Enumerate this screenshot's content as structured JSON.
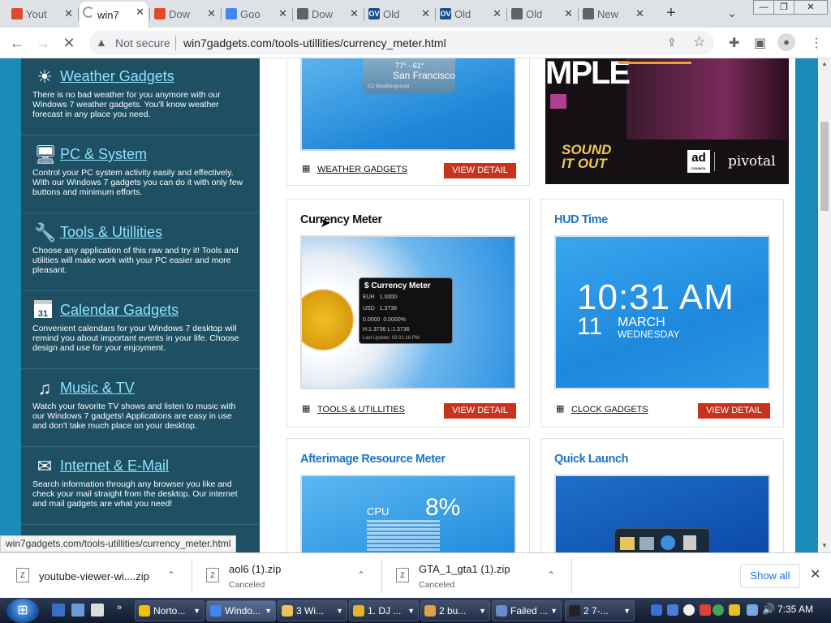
{
  "browser": {
    "tabs": [
      {
        "title": "Yout",
        "favicon": "windows-flag-icon",
        "color": "#e04b2b"
      },
      {
        "title": "win7",
        "favicon": "loading-icon",
        "color": "#9aa0a6",
        "active": true
      },
      {
        "title": "Dow",
        "favicon": "windows-flag-icon",
        "color": "#e04b2b"
      },
      {
        "title": "Goo",
        "favicon": "google-g-icon",
        "color": "#4285f4"
      },
      {
        "title": "Dow",
        "favicon": "globe-icon",
        "color": "#5f6368"
      },
      {
        "title": "Old",
        "favicon": "ov-icon",
        "color": "#1b4f8a",
        "badge": "OV"
      },
      {
        "title": "Old",
        "favicon": "ov-icon",
        "color": "#1b4f8a",
        "badge": "OV"
      },
      {
        "title": "Old",
        "favicon": "globe-icon",
        "color": "#5f6368"
      },
      {
        "title": "New",
        "favicon": "globe-icon",
        "color": "#5f6368"
      }
    ],
    "new_tab_glyph": "+",
    "tab_search_glyph": "⌄",
    "window_controls": {
      "minimize": "—",
      "maximize": "❐",
      "close": "✕"
    },
    "nav": {
      "back": "←",
      "forward": "→",
      "stop": "✕"
    },
    "security_label": "Not secure",
    "url": "win7gadgets.com/tools-utillities/currency_meter.html",
    "status_url": "win7gadgets.com/tools-utillities/currency_meter.html"
  },
  "sidebar": {
    "items": [
      {
        "title": "Weather Gadgets",
        "icon": "weather-icon",
        "glyph": "☀",
        "desc": "There is no bad weather for you anymore with our Windows 7 weather gadgets. You'll know weather forecast in any place you need."
      },
      {
        "title": "PC & System",
        "icon": "monitor-icon",
        "glyph": "🖥",
        "desc": "Control your PC system activity easily and effectively. With our Windows 7 gadgets you can do it with only few buttons and minimum efforts."
      },
      {
        "title": "Tools & Utillities",
        "icon": "wrench-icon",
        "glyph": "🔧",
        "desc": "Choose any application of this raw and try it! Tools and utilities will make work with your PC easier and more pleasant."
      },
      {
        "title": "Calendar Gadgets",
        "icon": "calendar-icon",
        "glyph": "31",
        "desc": "Convenient calendars for your Windows 7 desktop will remind you about important events in your life. Choose design and use for your enjoyment."
      },
      {
        "title": "Music & TV",
        "icon": "music-note-icon",
        "glyph": "♫",
        "desc": "Watch your favorite TV shows and listen to music with our Windows 7 gadgets! Applications are easy in use and don't take much place on your desktop."
      },
      {
        "title": "Internet & E-Mail",
        "icon": "envelope-icon",
        "glyph": "✉",
        "desc": "Search information through any browser you like and check your mail straight from the desktop. Our internet and mail gadgets are what you need!"
      }
    ]
  },
  "cards": {
    "top_left": {
      "category": "WEATHER GADGETS",
      "button": "VIEW DETAIL",
      "img_text": {
        "temps": "77° - 61°",
        "city": "San Francisco",
        "credit": "(C) Weatherground"
      }
    },
    "top_right": {
      "ad_title": "MPLE",
      "ad_brand": "SOUND IT OUT",
      "ad_logo1": "ad",
      "ad_logo1_sub": "COUNCIL",
      "ad_logo2": "pivotal"
    },
    "currency": {
      "title": "Currency Meter",
      "category": "TOOLS & UTILLITIES",
      "button": "VIEW DETAIL",
      "widget": {
        "title": "Currency Meter",
        "eur_label": "EUR",
        "eur_value": "1.0000",
        "usd_label": "USD",
        "usd_value": "1.3736",
        "pct1": "0.0000",
        "pct2": "0.0000%",
        "hl": "H:1.3736  L:1.3736",
        "updated": "Last Update: 02:01:18 PM"
      }
    },
    "hud": {
      "title": "HUD Time",
      "category": "CLOCK GADGETS",
      "button": "VIEW DETAIL",
      "time": "10:31 AM",
      "day": "11",
      "month": "MARCH",
      "weekday": "WEDNESDAY"
    },
    "afterimage": {
      "title": "Afterimage Resource Meter",
      "cpu_label": "CPU",
      "cpu_value": "8%"
    },
    "quick_launch": {
      "title": "Quick Launch"
    }
  },
  "downloads": {
    "items": [
      {
        "name": "youtube-viewer-wi....zip",
        "status": ""
      },
      {
        "name": "aol6 (1).zip",
        "status": "Canceled"
      },
      {
        "name": "GTA_1_gta1 (1).zip",
        "status": "Canceled"
      }
    ],
    "show_all": "Show all",
    "close": "✕"
  },
  "taskbar": {
    "tasks": [
      {
        "label": "Norto...",
        "color": "#f2c200"
      },
      {
        "label": "Windo...",
        "color": "#4285f4"
      },
      {
        "label": "3 Wi...",
        "color": "#e8c55a"
      },
      {
        "label": "1. DJ ...",
        "color": "#e6b422"
      },
      {
        "label": "2 bu...",
        "color": "#d9a441"
      },
      {
        "label": "Failed ...",
        "color": "#6a8ccf"
      },
      {
        "label": "2 7-...",
        "color": "#222222"
      }
    ],
    "clock": "7:35 AM"
  }
}
